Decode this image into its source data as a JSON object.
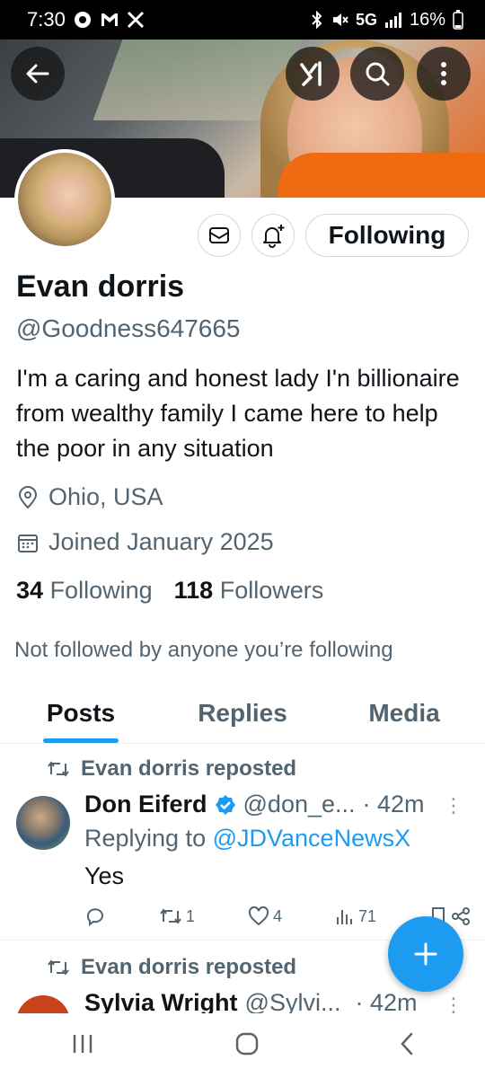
{
  "status_bar": {
    "time": "7:30",
    "network": "5G",
    "battery": "16%"
  },
  "profile": {
    "name": "Evan dorris",
    "handle": "@Goodness647665",
    "bio": "I'm a caring and honest lady I'n billionaire from wealthy family I came here to help the poor in any situation",
    "location": "Ohio, USA",
    "joined": "Joined January 2025",
    "following_count": "34",
    "following_label": "Following",
    "followers_count": "118",
    "followers_label": "Followers",
    "not_followed": "Not followed by anyone you’re following",
    "following_button": "Following"
  },
  "tabs": [
    {
      "label": "Posts",
      "active": true
    },
    {
      "label": "Replies",
      "active": false
    },
    {
      "label": "Media",
      "active": false
    }
  ],
  "posts": [
    {
      "repost_label": "Evan dorris reposted",
      "author": "Don Eiferd",
      "handle": "@don_e...",
      "time": "· 42m",
      "replying_to": "Replying to",
      "mention": "@JDVanceNewsX",
      "text": "Yes",
      "retweets": "1",
      "likes": "4",
      "views": "71"
    },
    {
      "repost_label": "Evan dorris reposted",
      "author": "Sylvia Wright",
      "handle": "@Sylvi...",
      "time": "· 42m"
    }
  ],
  "colors": {
    "accent": "#1d9bf0",
    "secondary_text": "#536471",
    "banner_orange": "#f06a12"
  },
  "icons": [
    "back-arrow-icon",
    "grok-icon",
    "search-icon",
    "more-vertical-icon",
    "mail-icon",
    "bell-plus-icon",
    "location-pin-icon",
    "calendar-icon",
    "repost-icon",
    "reply-icon",
    "like-icon",
    "views-icon",
    "bookmark-icon",
    "share-icon",
    "plus-icon"
  ]
}
